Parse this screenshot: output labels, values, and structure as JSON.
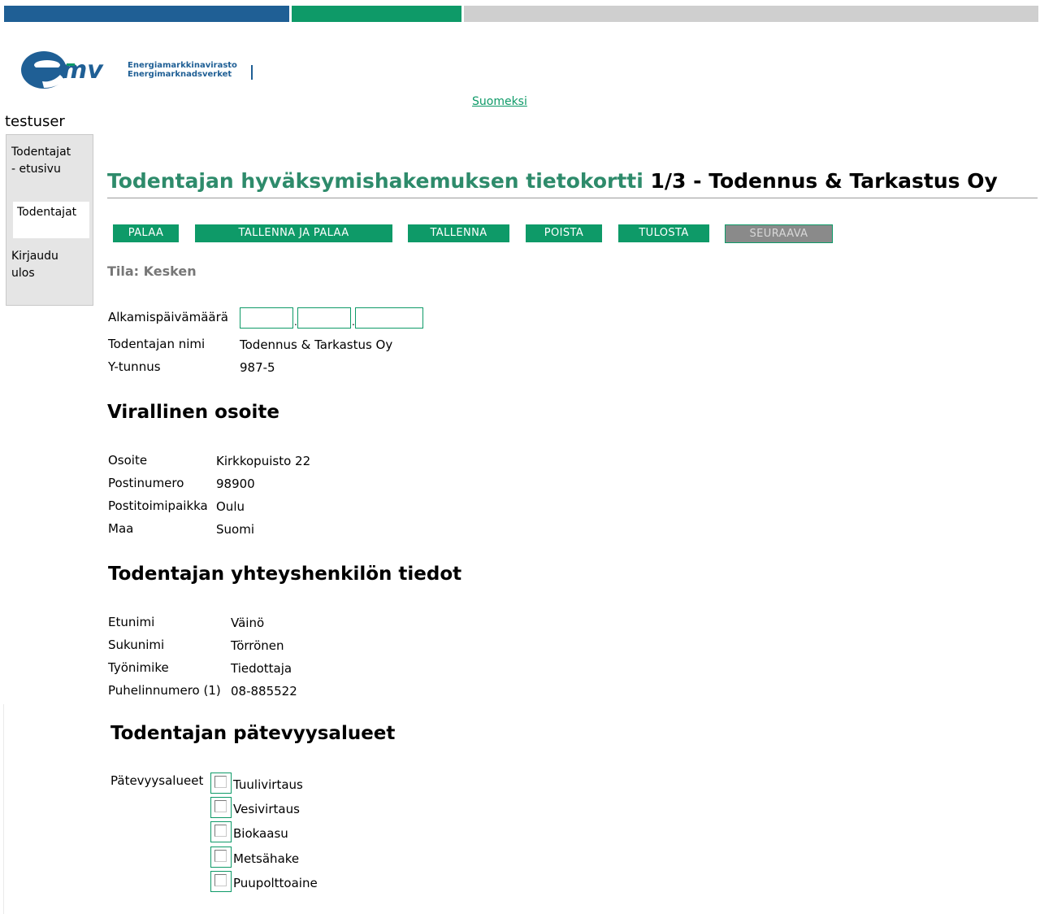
{
  "colors": {
    "blue": "#1f5f95",
    "green": "#0e9a68",
    "title_green": "#2e8b6b",
    "gray": "#cfcfcf"
  },
  "logo": {
    "mark": "emv",
    "line1": "Energiamarkkinavirasto",
    "line2": "Energimarknadsverket"
  },
  "language_link": "Suomeksi",
  "username": "testuser",
  "sidebar": {
    "item1_line1": "Todentajat",
    "item1_line2": "- etusivu",
    "item2": "Todentajat",
    "item3_line1": "Kirjaudu",
    "item3_line2": "ulos"
  },
  "title": {
    "green_part": "Todentajan hyväksymishakemuksen tietokortti",
    "black_part": "1/3 - Todennus & Tarkastus Oy"
  },
  "buttons": [
    "PALAA",
    "TALLENNA JA PALAA",
    "TALLENNA",
    "POISTA",
    "TULOSTA",
    "SEURAAVA"
  ],
  "status": "Tila: Kesken",
  "basic": {
    "start_date_label": "Alkamispäivämäärä",
    "date_sep": ".",
    "name_label": "Todentajan nimi",
    "name_value": "Todennus & Tarkastus Oy",
    "ytunnus_label": "Y-tunnus",
    "ytunnus_value": "987-5"
  },
  "address": {
    "heading": "Virallinen osoite",
    "rows": [
      {
        "label": "Osoite",
        "value": "Kirkkopuisto 22"
      },
      {
        "label": "Postinumero",
        "value": "98900"
      },
      {
        "label": "Postitoimipaikka",
        "value": "Oulu"
      },
      {
        "label": "Maa",
        "value": "Suomi"
      }
    ]
  },
  "contact": {
    "heading": "Todentajan yhteyshenkilön tiedot",
    "rows": [
      {
        "label": "Etunimi",
        "value": "Väinö"
      },
      {
        "label": "Sukunimi",
        "value": "Törrönen"
      },
      {
        "label": "Työnimike",
        "value": "Tiedottaja"
      },
      {
        "label": "Puhelinnumero (1)",
        "value": "08-885522"
      }
    ]
  },
  "competence": {
    "heading": "Todentajan pätevyysalueet",
    "label": "Pätevyysalueet",
    "options": [
      "Tuulivirtaus",
      "Vesivirtaus",
      "Biokaasu",
      "Metsähake",
      "Puupolttoaine"
    ]
  }
}
